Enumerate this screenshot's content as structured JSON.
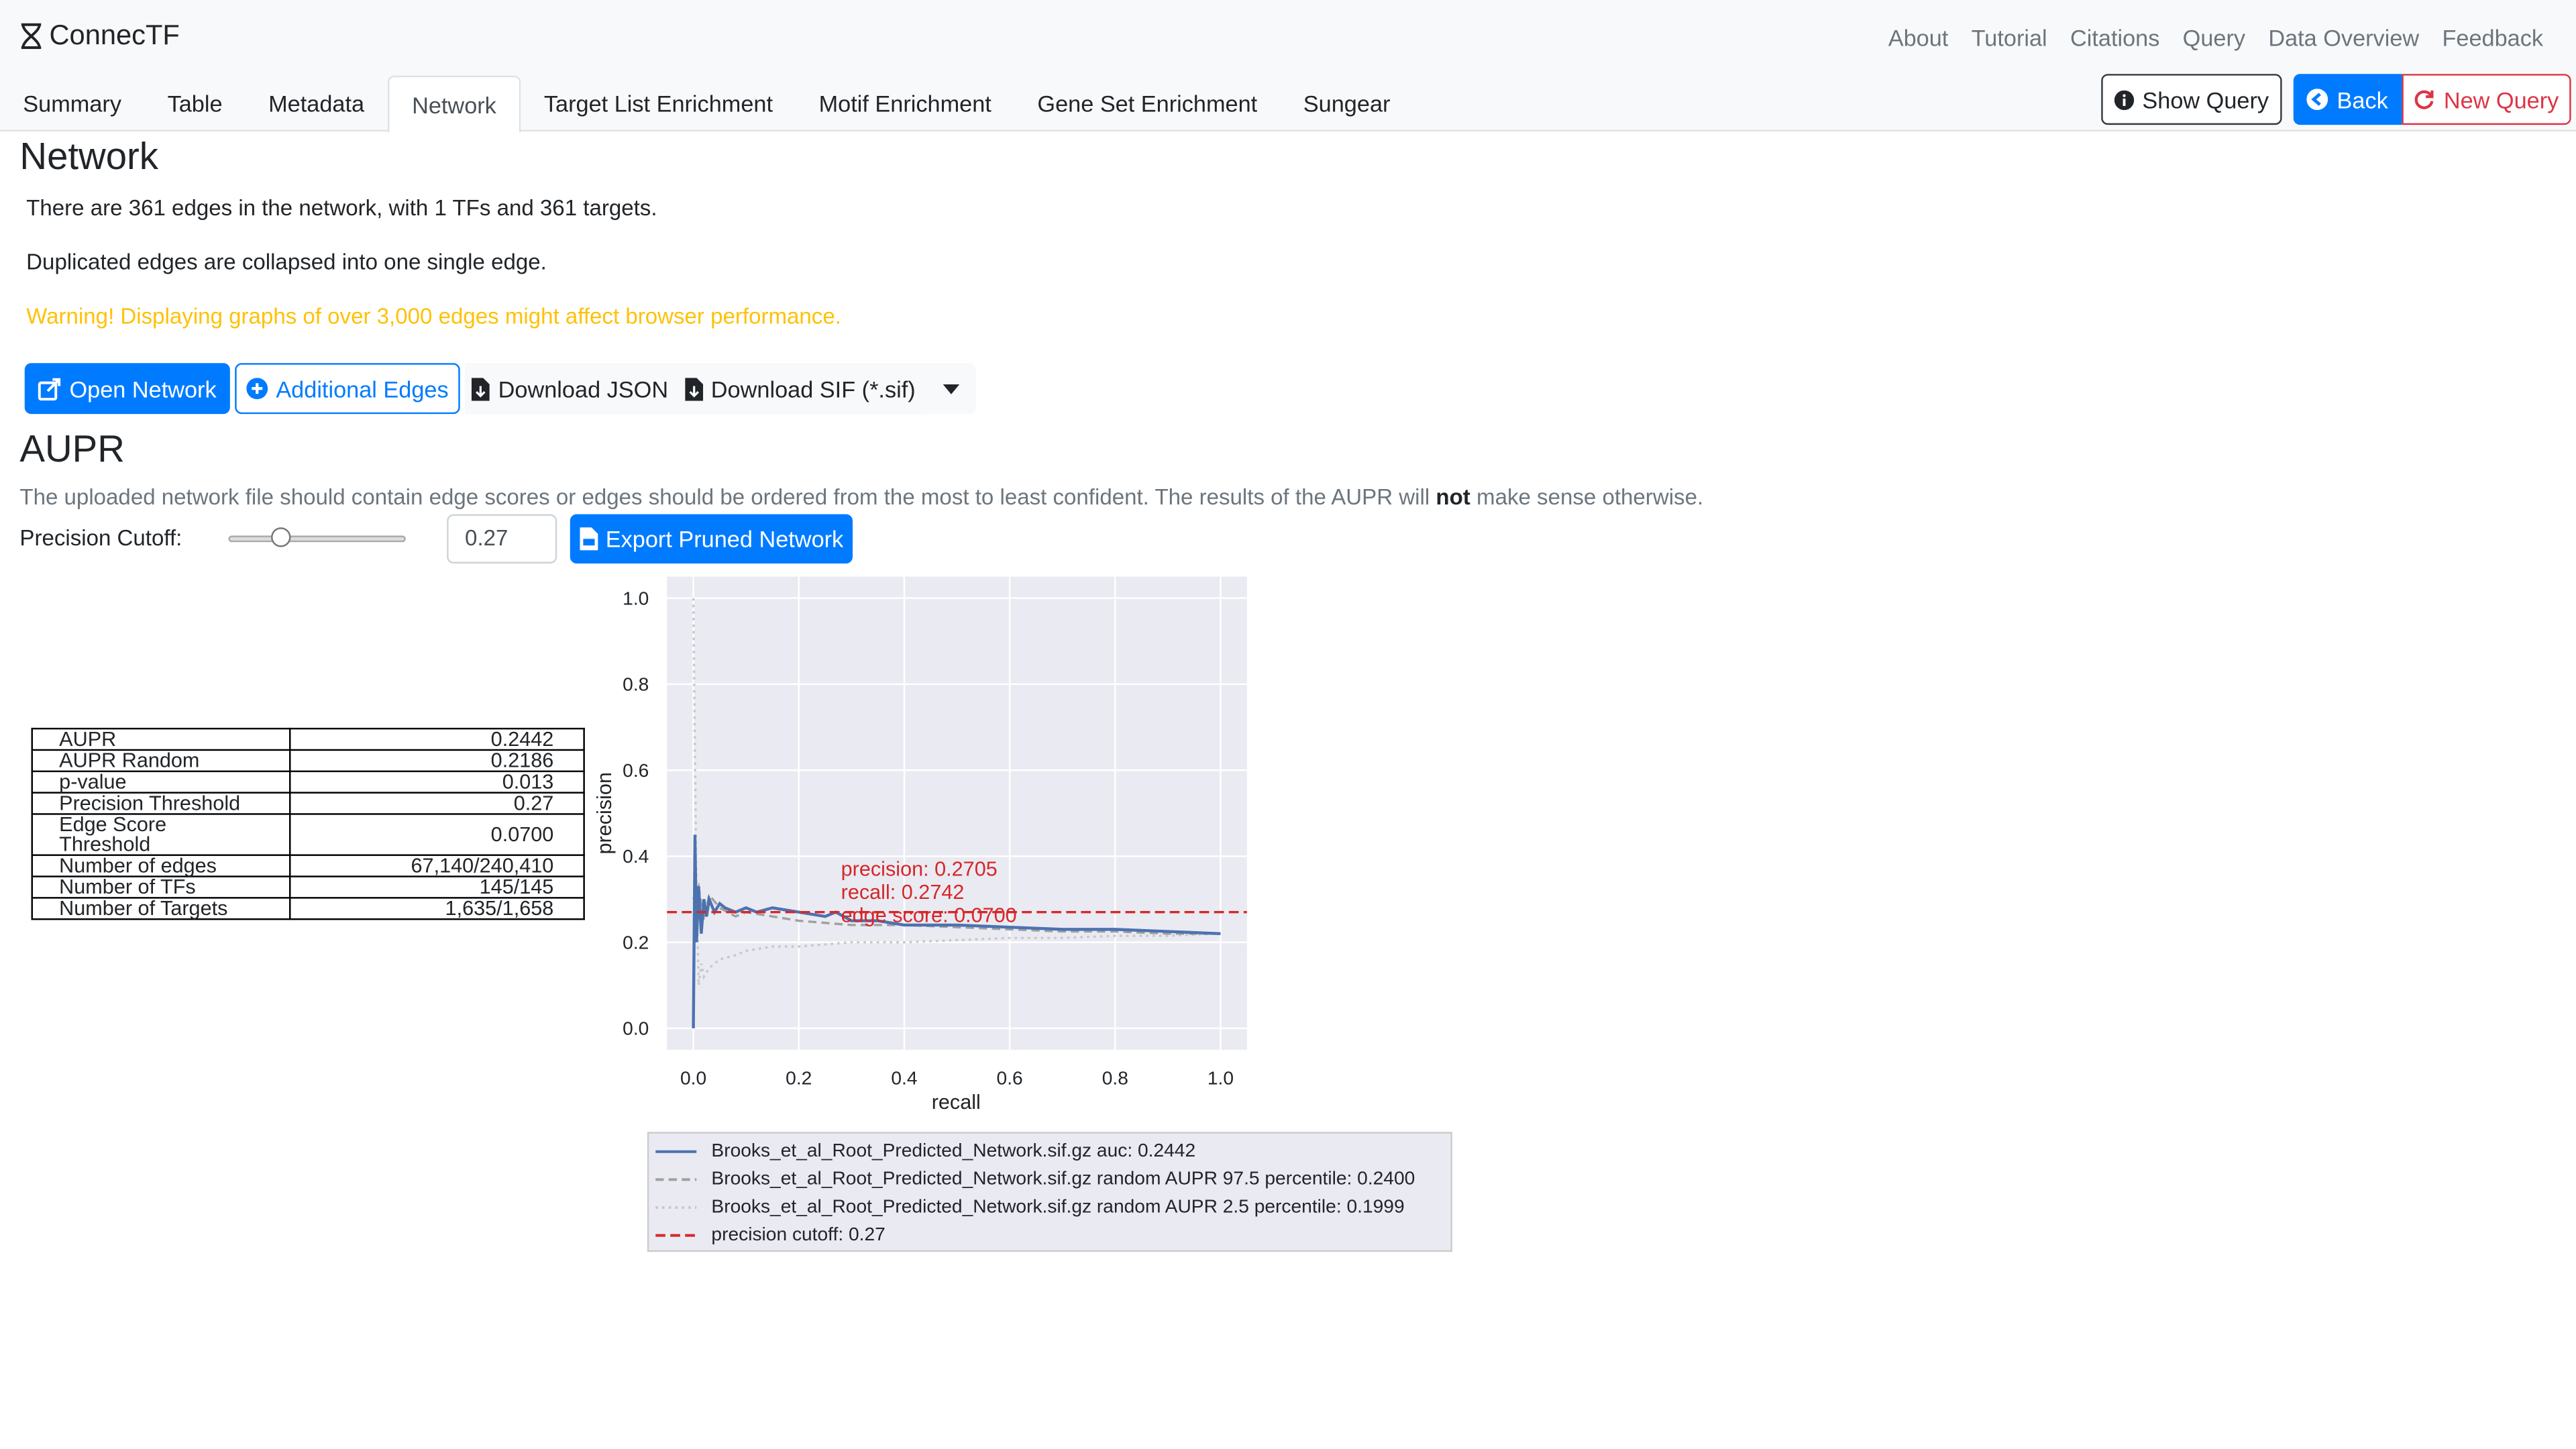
{
  "brand": {
    "name": "ConnecTF"
  },
  "top_links": [
    "About",
    "Tutorial",
    "Citations",
    "Query",
    "Data Overview",
    "Feedback"
  ],
  "tabs": [
    "Summary",
    "Table",
    "Metadata",
    "Network",
    "Target List Enrichment",
    "Motif Enrichment",
    "Gene Set Enrichment",
    "Sungear"
  ],
  "active_tab": "Network",
  "actions": {
    "show_query": "Show Query",
    "back": "Back",
    "new_query": "New Query"
  },
  "network": {
    "heading": "Network",
    "summary": "There are 361 edges in the network, with 1 TFs and 361 targets.",
    "duplicate_note": "Duplicated edges are collapsed into one single edge.",
    "warning": "Warning! Displaying graphs of over 3,000 edges might affect browser performance.",
    "buttons": {
      "open": "Open Network",
      "additional": "Additional Edges",
      "json": "Download JSON",
      "sif": "Download SIF (*.sif)"
    }
  },
  "aupr": {
    "heading": "AUPR",
    "note_before": "The uploaded network file should contain edge scores or edges should be ordered from the most to least confident. The results of the AUPR will ",
    "note_bold": "not",
    "note_after": " make sense otherwise.",
    "cutoff_label": "Precision Cutoff:",
    "cutoff_value": "0.27",
    "cutoff_level": 0.27,
    "export_label": "Export Pruned Network"
  },
  "stats": [
    {
      "key": "AUPR",
      "value": "0.2442"
    },
    {
      "key": "AUPR Random",
      "value": "0.2186"
    },
    {
      "key": "p-value",
      "value": "0.013"
    },
    {
      "key": "Precision Threshold",
      "value": "0.27"
    },
    {
      "key": "Edge Score Threshold",
      "value": "0.0700"
    },
    {
      "key": "Number of edges",
      "value": "67,140/240,410"
    },
    {
      "key": "Number of TFs",
      "value": "145/145"
    },
    {
      "key": "Number of Targets",
      "value": "1,635/1,658"
    }
  ],
  "chart_data": {
    "type": "line",
    "xlabel": "recall",
    "ylabel": "precision",
    "xlim": [
      -0.05,
      1.05
    ],
    "ylim": [
      -0.05,
      1.05
    ],
    "xticks": [
      "0.0",
      "0.2",
      "0.4",
      "0.6",
      "0.8",
      "1.0"
    ],
    "yticks": [
      "0.0",
      "0.2",
      "0.4",
      "0.6",
      "0.8",
      "1.0"
    ],
    "grid": true,
    "background": "#eaeaf2",
    "series": [
      {
        "name": "Brooks_et_al_Root_Predicted_Network.sif.gz auc: 0.2442",
        "color": "#4c72b0",
        "style": "solid",
        "x": [
          0.0,
          0.003,
          0.006,
          0.01,
          0.015,
          0.02,
          0.025,
          0.03,
          0.04,
          0.05,
          0.06,
          0.08,
          0.1,
          0.12,
          0.15,
          0.2,
          0.25,
          0.27,
          0.3,
          0.35,
          0.4,
          0.5,
          0.6,
          0.7,
          0.8,
          0.9,
          1.0
        ],
        "y": [
          0.0,
          0.45,
          0.2,
          0.33,
          0.22,
          0.3,
          0.26,
          0.3,
          0.27,
          0.29,
          0.28,
          0.27,
          0.28,
          0.27,
          0.28,
          0.27,
          0.26,
          0.27,
          0.25,
          0.25,
          0.24,
          0.24,
          0.235,
          0.23,
          0.23,
          0.225,
          0.22
        ]
      },
      {
        "name": "Brooks_et_al_Root_Predicted_Network.sif.gz random AUPR 97.5 percentile: 0.2400",
        "color": "#a0a0a0",
        "style": "dashed",
        "x": [
          0.0,
          0.01,
          0.02,
          0.03,
          0.05,
          0.08,
          0.1,
          0.15,
          0.2,
          0.3,
          0.4,
          0.5,
          0.6,
          0.7,
          0.8,
          0.9,
          1.0
        ],
        "y": [
          0.3,
          0.33,
          0.25,
          0.31,
          0.28,
          0.26,
          0.27,
          0.26,
          0.25,
          0.24,
          0.24,
          0.235,
          0.23,
          0.225,
          0.225,
          0.22,
          0.22
        ]
      },
      {
        "name": "Brooks_et_al_Root_Predicted_Network.sif.gz random AUPR 2.5 percentile: 0.1999",
        "color": "#c8c8c8",
        "style": "dotted",
        "x": [
          0.0,
          0.005,
          0.01,
          0.015,
          0.02,
          0.03,
          0.05,
          0.08,
          0.1,
          0.15,
          0.2,
          0.3,
          0.4,
          0.5,
          0.6,
          0.7,
          0.8,
          0.9,
          1.0
        ],
        "y": [
          1.0,
          0.4,
          0.1,
          0.15,
          0.12,
          0.14,
          0.16,
          0.17,
          0.18,
          0.19,
          0.19,
          0.2,
          0.2,
          0.205,
          0.21,
          0.21,
          0.215,
          0.215,
          0.22
        ]
      },
      {
        "name": "precision cutoff: 0.27",
        "color": "#d62728",
        "style": "dashed",
        "x": [
          -0.05,
          1.05
        ],
        "y": [
          0.27,
          0.27
        ]
      }
    ],
    "annotation": {
      "lines": [
        "precision: 0.2705",
        "recall: 0.2742",
        "edge score: 0.0700"
      ],
      "x": 0.28,
      "y": 0.4,
      "color": "#d62728"
    },
    "legend_position": "below"
  }
}
